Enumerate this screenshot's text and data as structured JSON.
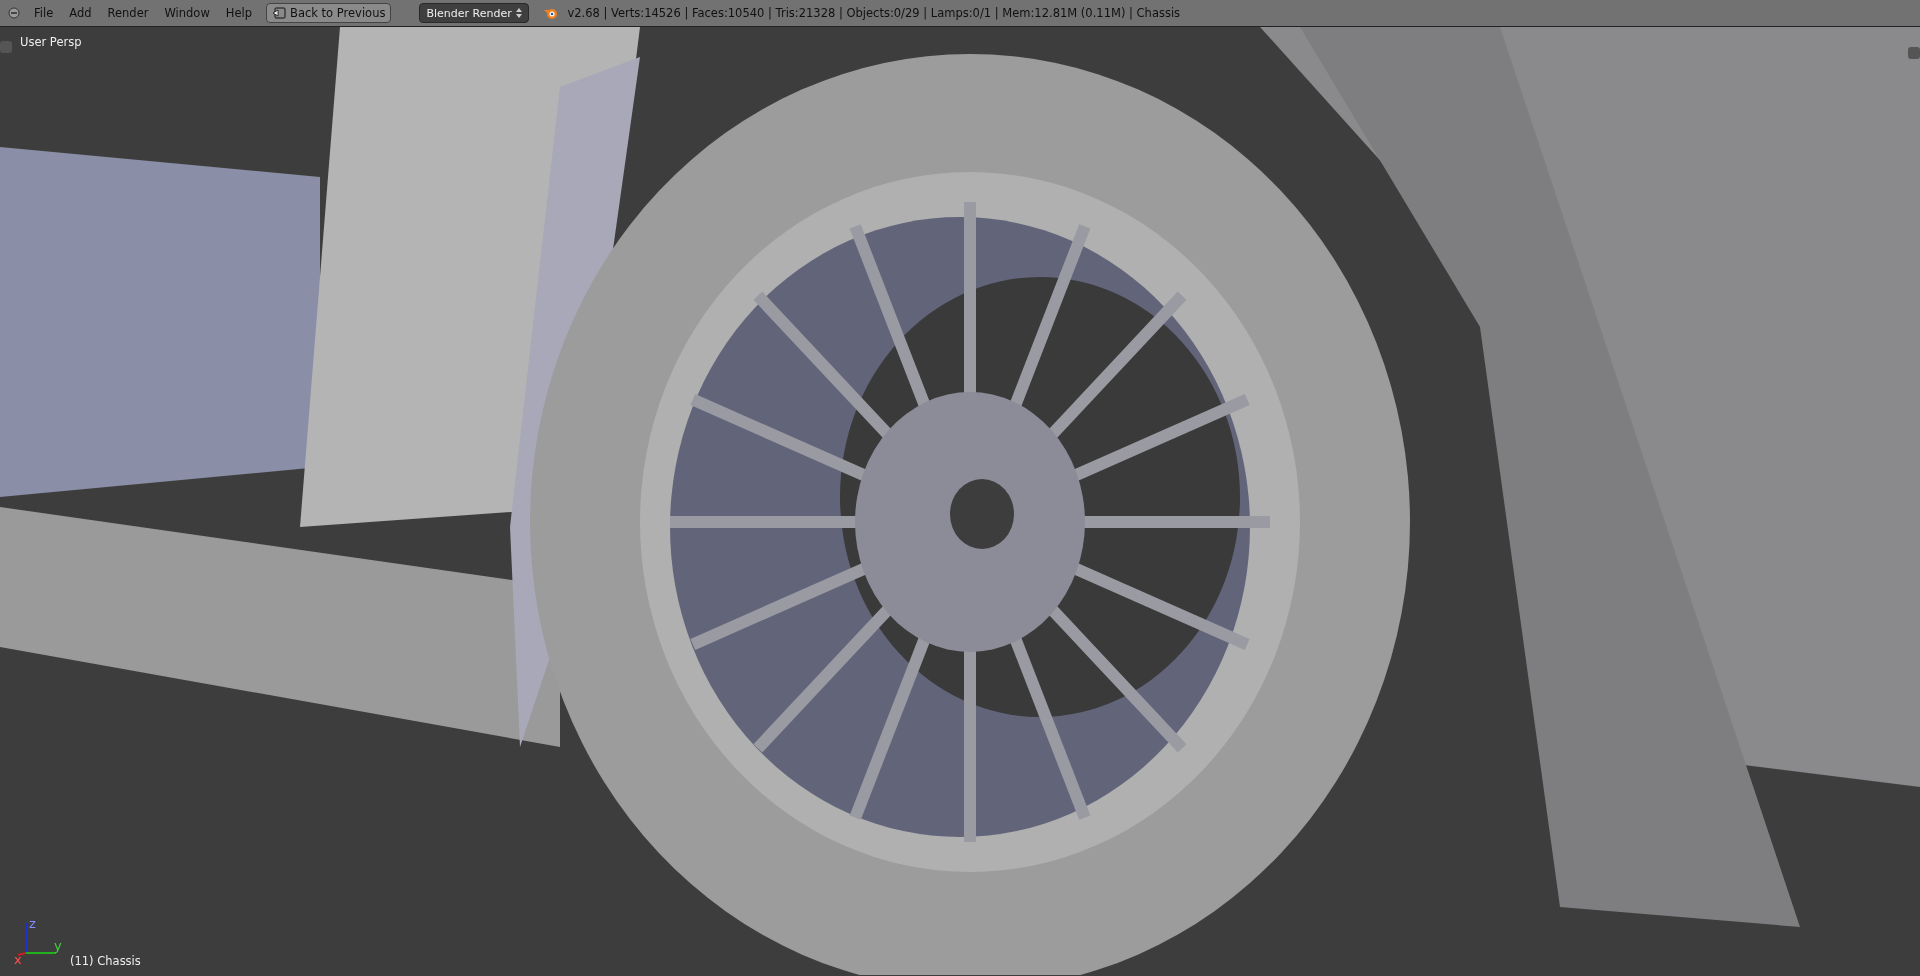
{
  "header": {
    "menu": [
      "File",
      "Add",
      "Render",
      "Window",
      "Help"
    ],
    "back_button": "Back to Previous",
    "render_engine": "Blender Render",
    "stats": "v2.68 | Verts:14526 | Faces:10540 | Tris:21328 | Objects:0/29 | Lamps:0/1 | Mem:12.81M (0.11M) | Chassis"
  },
  "viewport": {
    "view_label": "User Persp",
    "object_label": "(11) Chassis",
    "axes": [
      "x",
      "y",
      "z"
    ]
  }
}
